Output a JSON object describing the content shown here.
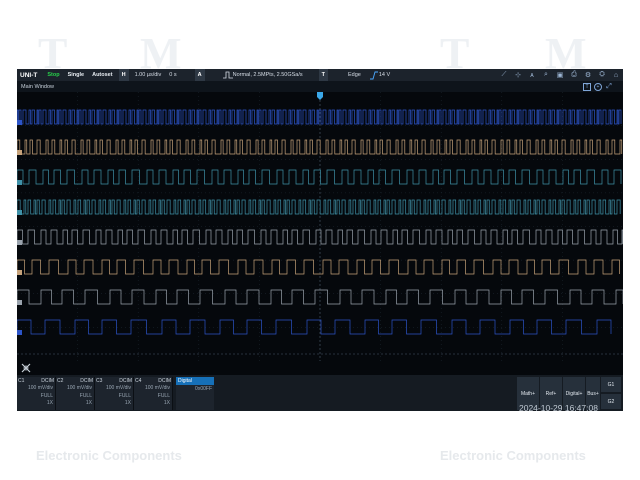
{
  "toolbar": {
    "logo": "UNI-T",
    "run_state": "Stop",
    "single": "Single",
    "autoset": "Autoset",
    "h_label": "H",
    "timebase": "1.00 µs/div",
    "h_offset": "0 s",
    "a_label": "A",
    "acq_info": "Normal, 2.5MPts, 2.50GSa/s",
    "t_label": "T",
    "trigger_type": "Edge",
    "trigger_level": "14 V",
    "accent": "#27d04a"
  },
  "window": {
    "title": "Main Window"
  },
  "channels": [
    {
      "name": "C1",
      "coupling": "DCIM",
      "scale": "100 mV/div",
      "bw": "FULL",
      "probe": "1X"
    },
    {
      "name": "C2",
      "coupling": "DCIM",
      "scale": "100 mV/div",
      "bw": "FULL",
      "probe": "1X"
    },
    {
      "name": "C3",
      "coupling": "DCIM",
      "scale": "100 mV/div",
      "bw": "FULL",
      "probe": "1X"
    },
    {
      "name": "C4",
      "coupling": "DCIM",
      "scale": "100 mV/div",
      "bw": "FULL",
      "probe": "1X"
    }
  ],
  "digital": {
    "name": "Digital",
    "value": "0x00FF"
  },
  "bottom_buttons": {
    "math": "Math+",
    "ref": "Ref+",
    "digital": "Digital+",
    "bus": "Bus+",
    "g1": "G1",
    "g2": "G2"
  },
  "datetime": "2024-10-29 16:47:08",
  "watermark": {
    "left": "Electronic Components",
    "right": "Electronic Components"
  },
  "traces": [
    {
      "color": "#2c54c8",
      "period": 4,
      "duty": 0.5
    },
    {
      "color": "#c6a27a",
      "period": 7,
      "duty": 0.35
    },
    {
      "color": "#3f91a8",
      "period": 13,
      "duty": 0.5
    },
    {
      "color": "#3f91a8",
      "period": 5,
      "duty": 0.45
    },
    {
      "color": "#9aa3ad",
      "period": 11,
      "duty": 0.5
    },
    {
      "color": "#c6a27a",
      "period": 17,
      "duty": 0.5
    },
    {
      "color": "#9aa3ad",
      "period": 23,
      "duty": 0.5
    },
    {
      "color": "#2c54c8",
      "period": 29,
      "duty": 0.5
    }
  ]
}
